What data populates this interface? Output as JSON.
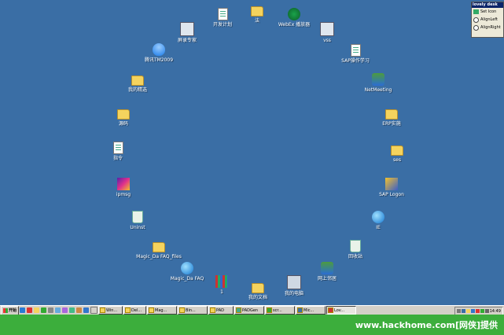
{
  "desktop": {
    "background_color": "#3a6ea5",
    "icons": [
      {
        "label": "开发计划",
        "icon": "document-icon"
      },
      {
        "label": "法",
        "icon": "folder-icon"
      },
      {
        "label": "WebEx 播放器",
        "icon": "media-player-icon"
      },
      {
        "label": "vss",
        "icon": "app-icon"
      },
      {
        "label": "SAP操作学习",
        "icon": "document-icon"
      },
      {
        "label": "NetMeeting",
        "icon": "network-icon"
      },
      {
        "label": "ERP实施",
        "icon": "folder-icon"
      },
      {
        "label": "ses",
        "icon": "folder-icon"
      },
      {
        "label": "SAP Logon",
        "icon": "key-icon"
      },
      {
        "label": "IE",
        "icon": "internet-explorer-icon"
      },
      {
        "label": "回收站",
        "icon": "recycle-bin-icon"
      },
      {
        "label": "网上邻居",
        "icon": "network-icon"
      },
      {
        "label": "我的电脑",
        "icon": "computer-icon"
      },
      {
        "label": "我的文档",
        "icon": "folder-icon"
      },
      {
        "label": "1",
        "icon": "archive-icon"
      },
      {
        "label": "Magic_Da FAQ",
        "icon": "internet-explorer-icon"
      },
      {
        "label": "Magic_Da FAQ_files",
        "icon": "folder-icon"
      },
      {
        "label": "Uninst",
        "icon": "recycle-bin-icon"
      },
      {
        "label": "ipmsg",
        "icon": "app-colorful-icon"
      },
      {
        "label": "指令",
        "icon": "document-icon"
      },
      {
        "label": "源码",
        "icon": "folder-icon"
      },
      {
        "label": "我的精选",
        "icon": "folder-icon"
      },
      {
        "label": "腾讯TM2009",
        "icon": "qq-icon"
      },
      {
        "label": "屏录专家",
        "icon": "app-icon"
      }
    ]
  },
  "lovely_desk_panel": {
    "title": "lovely desk",
    "set_icon_label": "Set Icon",
    "options": [
      "AlignLeft",
      "AlignRight"
    ]
  },
  "taskbar": {
    "start_label": "开始",
    "tasks": [
      {
        "label": "Win..."
      },
      {
        "label": "Del..."
      },
      {
        "label": "Mag..."
      },
      {
        "label": "Bin..."
      },
      {
        "label": "PAD"
      },
      {
        "label": "PADGen"
      },
      {
        "label": "scr..."
      },
      {
        "label": "Mic..."
      },
      {
        "label": "Lov...",
        "active": true
      }
    ],
    "clock": "14:49"
  },
  "footer": {
    "watermark": "www.hackhome.com[网侠]提供",
    "color": "#3cae3c"
  }
}
